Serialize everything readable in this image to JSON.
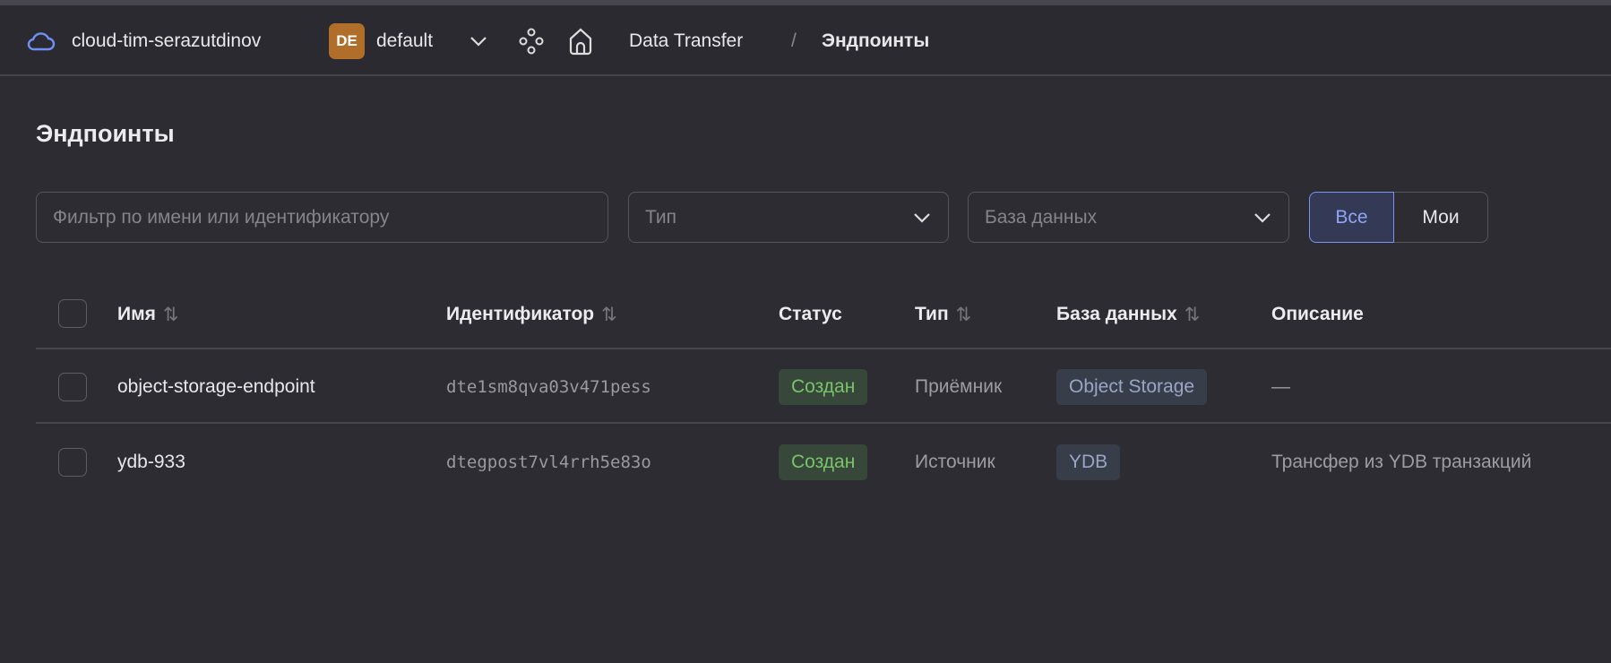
{
  "header": {
    "cloud": "cloud-tim-serazutdinov",
    "folder_badge": "DE",
    "folder": "default",
    "breadcrumb": [
      "Data Transfer",
      "Эндпоинты"
    ],
    "separator": "/"
  },
  "page": {
    "title": "Эндпоинты"
  },
  "filters": {
    "search_placeholder": "Фильтр по имени или идентификатору",
    "type_placeholder": "Тип",
    "db_placeholder": "База данных",
    "seg_all": "Все",
    "seg_mine": "Мои"
  },
  "table": {
    "columns": [
      "Имя",
      "Идентификатор",
      "Статус",
      "Тип",
      "База данных",
      "Описание"
    ],
    "rows": [
      {
        "name": "object-storage-endpoint",
        "id": "dte1sm8qva03v471pess",
        "status": "Создан",
        "type": "Приёмник",
        "db": "Object Storage",
        "desc": "—"
      },
      {
        "name": "ydb-933",
        "id": "dtegpost7vl4rrh5e83o",
        "status": "Создан",
        "type": "Источник",
        "db": "YDB",
        "desc": "Трансфер из YDB транзакций"
      }
    ]
  },
  "colors": {
    "accent": "#7b93ef",
    "status_ok": "#79c36b",
    "folder_badge": "#b06e2a"
  }
}
